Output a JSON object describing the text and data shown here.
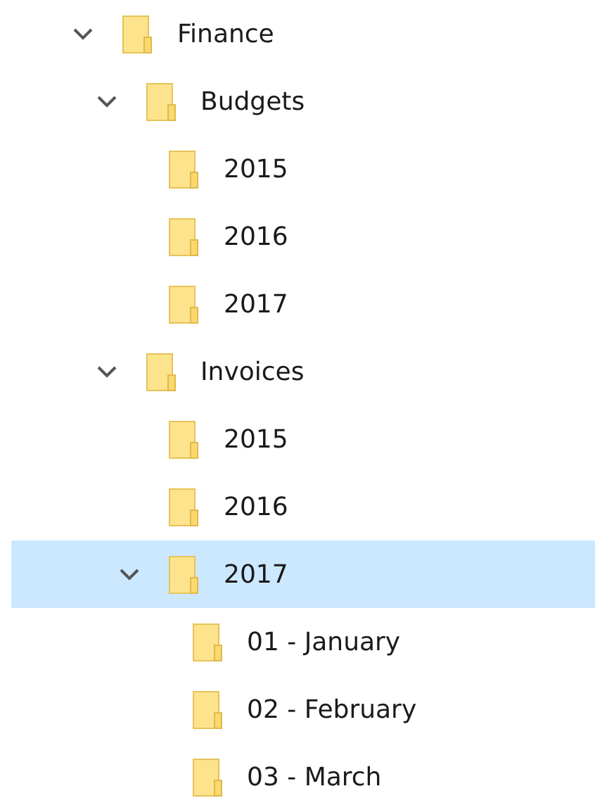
{
  "tree": [
    {
      "label": "Finance",
      "expanded": true,
      "selected": false,
      "children": [
        {
          "label": "Budgets",
          "expanded": true,
          "selected": false,
          "children": [
            {
              "label": "2015",
              "selected": false
            },
            {
              "label": "2016",
              "selected": false
            },
            {
              "label": "2017",
              "selected": false
            }
          ]
        },
        {
          "label": "Invoices",
          "expanded": true,
          "selected": false,
          "children": [
            {
              "label": "2015",
              "selected": false
            },
            {
              "label": "2016",
              "selected": false
            },
            {
              "label": "2017",
              "expanded": true,
              "selected": true,
              "children": [
                {
                  "label": "01 - January",
                  "selected": false
                },
                {
                  "label": "02 - February",
                  "selected": false
                },
                {
                  "label": "03 - March",
                  "selected": false
                }
              ]
            }
          ]
        }
      ]
    }
  ]
}
